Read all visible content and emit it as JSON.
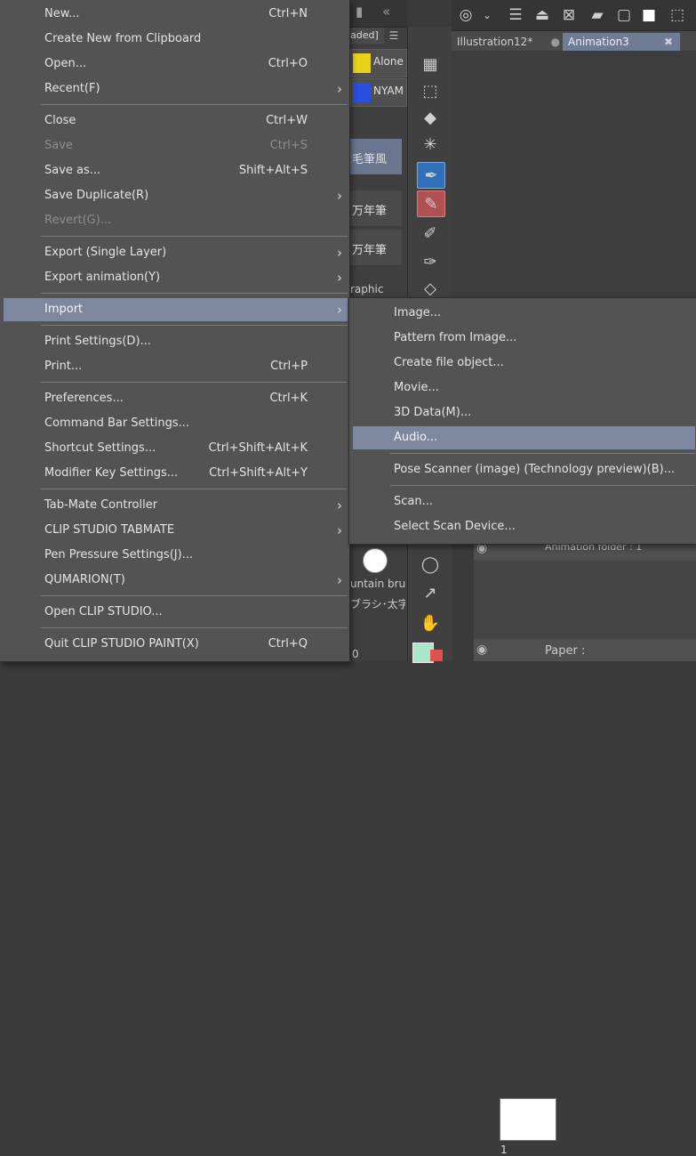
{
  "background": {
    "panel_tab": "aded]",
    "brushes": [
      {
        "label": "Alone",
        "color": "#e8d21a"
      },
      {
        "label": "NYAM",
        "color": "#2a4fe0"
      }
    ],
    "brush_list": [
      {
        "label": "毛筆風"
      },
      {
        "label": "万年筆"
      },
      {
        "label": "万年筆"
      }
    ],
    "graphic_label": "raphic",
    "fountain_label": "untain brus",
    "brush_jp_label": "ブラシ･太字",
    "size_value": "0",
    "doc_tabs": [
      {
        "label": "Illustration12*"
      },
      {
        "label": "Animation3"
      }
    ],
    "close_glyph": "✖",
    "layers": {
      "folder_label": "Animation folder : 1",
      "frame_number": "1",
      "paper_label": "Paper :"
    }
  },
  "main_menu": {
    "items": [
      {
        "label": "New...",
        "shortcut": "Ctrl+N"
      },
      {
        "label": "Create New from Clipboard",
        "shortcut": ""
      },
      {
        "label": "Open...",
        "shortcut": "Ctrl+O"
      },
      {
        "label": "Recent(F)",
        "shortcut": ""
      },
      {
        "label": "Close",
        "shortcut": "Ctrl+W"
      },
      {
        "label": "Save",
        "shortcut": "Ctrl+S"
      },
      {
        "label": "Save as...",
        "shortcut": "Shift+Alt+S"
      },
      {
        "label": "Save Duplicate(R)",
        "shortcut": ""
      },
      {
        "label": "Revert(G)...",
        "shortcut": ""
      },
      {
        "label": "Export (Single Layer)",
        "shortcut": ""
      },
      {
        "label": "Export animation(Y)",
        "shortcut": ""
      },
      {
        "label": "Import",
        "shortcut": ""
      },
      {
        "label": "Print Settings(D)...",
        "shortcut": ""
      },
      {
        "label": "Print...",
        "shortcut": "Ctrl+P"
      },
      {
        "label": "Preferences...",
        "shortcut": "Ctrl+K"
      },
      {
        "label": "Command Bar Settings...",
        "shortcut": ""
      },
      {
        "label": "Shortcut Settings...",
        "shortcut": "Ctrl+Shift+Alt+K"
      },
      {
        "label": "Modifier Key Settings...",
        "shortcut": "Ctrl+Shift+Alt+Y"
      },
      {
        "label": "Tab-Mate Controller",
        "shortcut": ""
      },
      {
        "label": "CLIP STUDIO TABMATE",
        "shortcut": ""
      },
      {
        "label": "Pen Pressure Settings(J)...",
        "shortcut": ""
      },
      {
        "label": "QUMARION(T)",
        "shortcut": ""
      },
      {
        "label": "Open CLIP STUDIO...",
        "shortcut": ""
      },
      {
        "label": "Quit CLIP STUDIO PAINT(X)",
        "shortcut": "Ctrl+Q"
      }
    ]
  },
  "import_submenu": {
    "items": [
      {
        "label": "Image..."
      },
      {
        "label": "Pattern from Image..."
      },
      {
        "label": "Create file object..."
      },
      {
        "label": "Movie..."
      },
      {
        "label": "3D Data(M)..."
      },
      {
        "label": "Audio..."
      },
      {
        "label": "Pose Scanner (image) (Technology preview)(B)..."
      },
      {
        "label": "Scan..."
      },
      {
        "label": "Select Scan Device..."
      }
    ]
  },
  "colors": {
    "highlight": "#7d87a0",
    "menu_bg": "#535353",
    "active_tab": "#6f7c95"
  }
}
